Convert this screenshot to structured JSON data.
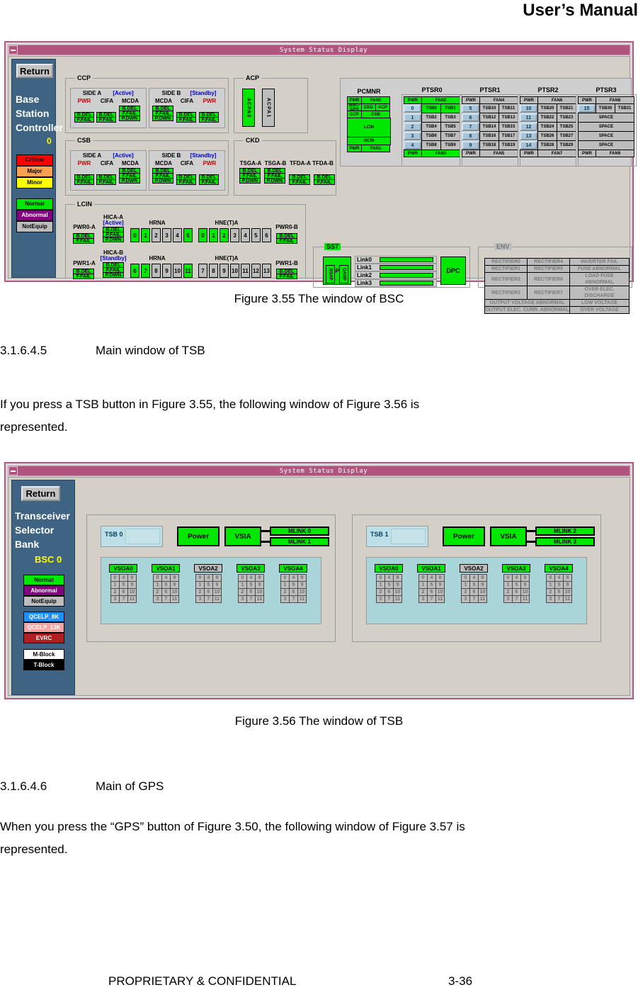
{
  "page": {
    "header_title": "User’s Manual",
    "footer_left": "PROPRIETARY & CONFIDENTIAL",
    "footer_right": "3-36"
  },
  "figures": {
    "fig355_caption": "Figure 3.55 The window of BSC",
    "fig356_caption": "Figure 3.56 The window of TSB"
  },
  "sections": [
    {
      "number": "3.1.6.4.5",
      "title": "Main window of TSB",
      "body_line1": "If you press a TSB button in Figure 3.55, the following window of  Figure 3.56 is",
      "body_line2": "represented."
    },
    {
      "number": "3.1.6.4.6",
      "title": "Main of GPS",
      "body_line1": "When you press the “GPS” button of Figure 3.50, the following window of Figure 3.57 is",
      "body_line2": "represented."
    }
  ],
  "bsc_window": {
    "titlebar": "System Status Display",
    "sidebar": {
      "return_label": "Return",
      "label_lines": [
        "Base",
        "Station",
        "Controller"
      ],
      "instance": "0",
      "legend_alarm": [
        {
          "label": "Critical",
          "color": "#ff0000",
          "text": "#000000"
        },
        {
          "label": "Major",
          "color": "#f9a055",
          "text": "#000000"
        },
        {
          "label": "Minor",
          "color": "#ffff00",
          "text": "#000000"
        }
      ],
      "legend_state": [
        {
          "label": "Normal",
          "color": "#00e800",
          "text": "#000000"
        },
        {
          "label": "Abnormal",
          "color": "#800080",
          "text": "#ffffff"
        },
        {
          "label": "NotEquip",
          "color": "#bdbdbd",
          "text": "#000000"
        }
      ]
    },
    "ccp": {
      "group_label": "CCP",
      "side_a": {
        "title": "SIDE A",
        "state": "[Active]",
        "columns": [
          "PWR",
          "CIFA",
          "MCDA"
        ]
      },
      "side_b": {
        "title": "SIDE B",
        "state": "[Standby]",
        "columns": [
          "MCDA",
          "CIFA",
          "PWR"
        ]
      },
      "cells": [
        "B.DEL",
        "F.FAIL",
        "P.DWN"
      ]
    },
    "csb": {
      "group_label": "CSB",
      "side_a": {
        "title": "SIDE A",
        "state": "[Active]",
        "columns": [
          "PWR",
          "CIFA",
          "MCDA"
        ]
      },
      "side_b": {
        "title": "SIDE B",
        "state": "[Standby]",
        "columns": [
          "MCDA",
          "CIFA",
          "PWR"
        ]
      },
      "cells": [
        "B.DEL",
        "F.FAIL",
        "P.DWN"
      ]
    },
    "acp": {
      "group_label": "ACP",
      "units": [
        {
          "label": "ACPA0",
          "state": "normal"
        },
        {
          "label": "ACPA1",
          "state": "notequip"
        }
      ]
    },
    "ckd": {
      "group_label": "CKD",
      "columns": [
        "TSGA-A",
        "TSGA-B",
        "TFDA-A",
        "TFDA-B"
      ],
      "tsga_cells": [
        "B.DEL",
        "F.FAIL",
        "P.DWN"
      ],
      "tfda_cells": [
        "B.DEL",
        "F.FAIL"
      ]
    },
    "lcin": {
      "group_label": "LCIN",
      "row_a": {
        "pwr_left": "PWR0-A",
        "hica": "HICA-A",
        "hica_state": "[Active]",
        "hica_cells": [
          "B.DEL",
          "F.FAIL",
          "P.DWN"
        ],
        "hrna_label": "HRNA",
        "hrna_slots": [
          {
            "n": "0",
            "on": true
          },
          {
            "n": "1",
            "on": true
          },
          {
            "n": "2",
            "on": false
          },
          {
            "n": "3",
            "on": false
          },
          {
            "n": "4",
            "on": false
          },
          {
            "n": "5",
            "on": true
          }
        ],
        "hnet_label": "HNE(T)A",
        "hnet_slots": [
          {
            "n": "0",
            "on": true
          },
          {
            "n": "1",
            "on": true
          },
          {
            "n": "2",
            "on": true
          },
          {
            "n": "3",
            "on": false
          },
          {
            "n": "4",
            "on": false
          },
          {
            "n": "5",
            "on": false
          },
          {
            "n": "6",
            "on": false
          }
        ],
        "pwr_right": "PWR0-B",
        "pwr_cells": [
          "B.DEL",
          "F.FAIL"
        ]
      },
      "row_b": {
        "pwr_left": "PWR1-A",
        "hica": "HICA-B",
        "hica_state": "[Standby]",
        "hica_cells": [
          "B.DEL",
          "F.FAIL",
          "P.DWN"
        ],
        "hrna_label": "HRNA",
        "hrna_slots": [
          {
            "n": "6",
            "on": true
          },
          {
            "n": "7",
            "on": true
          },
          {
            "n": "8",
            "on": false
          },
          {
            "n": "9",
            "on": false
          },
          {
            "n": "10",
            "on": false
          },
          {
            "n": "11",
            "on": true
          }
        ],
        "hnet_label": "HNE(T)A",
        "hnet_slots": [
          {
            "n": "7",
            "on": false
          },
          {
            "n": "8",
            "on": false
          },
          {
            "n": "9",
            "on": false
          },
          {
            "n": "10",
            "on": false
          },
          {
            "n": "11",
            "on": false
          },
          {
            "n": "12",
            "on": false
          },
          {
            "n": "13",
            "on": false
          }
        ],
        "pwr_right": "PWR1-B",
        "pwr_cells": [
          "B.DEL",
          "F.FAIL"
        ]
      }
    },
    "racks": {
      "pcmnr": {
        "title": "PCMNR",
        "rows": [
          [
            {
              "t": "PWR",
              "s": "g",
              "w": 1
            },
            {
              "t": "FAN0",
              "s": "g",
              "w": 2
            }
          ],
          [
            {
              "t": "BSC-GPS",
              "s": "g",
              "w": 1
            },
            {
              "t": "CKD",
              "s": "g",
              "w": 1
            },
            {
              "t": "ACP",
              "s": "g",
              "w": 1
            }
          ],
          [
            {
              "t": "CCP",
              "s": "g",
              "w": 1
            },
            {
              "t": "CSB",
              "s": "g",
              "w": 2
            }
          ],
          [
            {
              "t": "LCIN",
              "s": "g",
              "w": 3
            }
          ],
          [
            {
              "t": "GCIN",
              "s": "g",
              "w": 3
            }
          ],
          [
            {
              "t": "PWR",
              "s": "g",
              "w": 1
            },
            {
              "t": "FAN1",
              "s": "g",
              "w": 2
            }
          ]
        ]
      },
      "ptsr": [
        {
          "title": "PTSR0",
          "top": [
            "PWR",
            "FAN2"
          ],
          "bottom": [
            "PWR",
            "FAN3"
          ],
          "header_state": "g",
          "rows": [
            {
              "btn": "0",
              "btn_on": true,
              "tsb": [
                "TSB0",
                "TSB1"
              ],
              "tsb_state": "g"
            },
            {
              "btn": "1",
              "btn_on": false,
              "tsb": [
                "TSB2",
                "TSB3"
              ],
              "tsb_state": "ng"
            },
            {
              "btn": "2",
              "btn_on": false,
              "tsb": [
                "TSB4",
                "TSB5"
              ],
              "tsb_state": "ng"
            },
            {
              "btn": "3",
              "btn_on": false,
              "tsb": [
                "TSB6",
                "TSB7"
              ],
              "tsb_state": "ng"
            },
            {
              "btn": "4",
              "btn_on": false,
              "tsb": [
                "TSB8",
                "TSB9"
              ],
              "tsb_state": "ng"
            }
          ]
        },
        {
          "title": "PTSR1",
          "top": [
            "PWR",
            "FAN4"
          ],
          "bottom": [
            "PWR",
            "FAN5"
          ],
          "header_state": "ng",
          "rows": [
            {
              "btn": "5",
              "btn_on": false,
              "tsb": [
                "TSB10",
                "TSB11"
              ],
              "tsb_state": "ng"
            },
            {
              "btn": "6",
              "btn_on": false,
              "tsb": [
                "TSB12",
                "TSB13"
              ],
              "tsb_state": "ng"
            },
            {
              "btn": "7",
              "btn_on": false,
              "tsb": [
                "TSB14",
                "TSB15"
              ],
              "tsb_state": "ng"
            },
            {
              "btn": "8",
              "btn_on": false,
              "tsb": [
                "TSB16",
                "TSB17"
              ],
              "tsb_state": "ng"
            },
            {
              "btn": "9",
              "btn_on": false,
              "tsb": [
                "TSB18",
                "TSB19"
              ],
              "tsb_state": "ng"
            }
          ]
        },
        {
          "title": "PTSR2",
          "top": [
            "PWR",
            "FAN6"
          ],
          "bottom": [
            "PWR",
            "FAN7"
          ],
          "header_state": "ng",
          "rows": [
            {
              "btn": "10",
              "btn_on": false,
              "tsb": [
                "TSB20",
                "TSB21"
              ],
              "tsb_state": "ng"
            },
            {
              "btn": "11",
              "btn_on": false,
              "tsb": [
                "TSB22",
                "TSB23"
              ],
              "tsb_state": "ng"
            },
            {
              "btn": "12",
              "btn_on": false,
              "tsb": [
                "TSB24",
                "TSB25"
              ],
              "tsb_state": "ng"
            },
            {
              "btn": "13",
              "btn_on": false,
              "tsb": [
                "TSB26",
                "TSB27"
              ],
              "tsb_state": "ng"
            },
            {
              "btn": "14",
              "btn_on": false,
              "tsb": [
                "TSB28",
                "TSB29"
              ],
              "tsb_state": "ng"
            }
          ]
        },
        {
          "title": "PTSR3",
          "top": [
            "PWR",
            "FAN8"
          ],
          "bottom": [
            "PWR",
            "FAN9"
          ],
          "header_state": "ng",
          "rows": [
            {
              "btn": "15",
              "btn_on": false,
              "tsb": [
                "TSB30",
                "TSB31"
              ],
              "tsb_state": "ng"
            },
            {
              "span": "SPACE"
            },
            {
              "span": "SPACE"
            },
            {
              "span": "SPACE"
            },
            {
              "span": "SPACE"
            }
          ]
        }
      ]
    },
    "ss7": {
      "group_label": "SS7",
      "opc_label": "OPC",
      "opc_units": [
        "BSAP",
        "OAMP"
      ],
      "links": [
        "Link0",
        "Link1",
        "Link2",
        "Link3"
      ],
      "dpc_label": "DPC"
    },
    "env": {
      "group_label": "ENV",
      "rows": [
        [
          "RECTIFIER0",
          "RECTIFIER4",
          "INVERTER FAIL"
        ],
        [
          "RECTIFIER1",
          "RECTIFIER5",
          "FUSE ABNORMAL"
        ],
        [
          "RECTIFIER2",
          "RECTIFIER6",
          "LOAD FUSE ABNORMAL"
        ],
        [
          "RECTIFIER3",
          "RECTIFIER7",
          "OVER ELEC. DISCHARGE"
        ]
      ],
      "wide_rows": [
        [
          "OUTPUT VOLTAGE ABNORMAL",
          "LOW VOLTAGE"
        ],
        [
          "OUTPUT ELEC. CURR. ABNORMAL",
          "OVER VOLTAGE"
        ]
      ]
    }
  },
  "tsb_window": {
    "titlebar": "System Status Display",
    "sidebar": {
      "return_label": "Return",
      "label_lines": [
        "Transceiver",
        "Selector",
        "Bank"
      ],
      "instance": "BSC 0",
      "legend_state": [
        {
          "label": "Normal",
          "color": "#00e800",
          "text": "#000000"
        },
        {
          "label": "Abnormal",
          "color": "#800080",
          "text": "#ffffff"
        },
        {
          "label": "NotEquip",
          "color": "#bdbdbd",
          "text": "#000000"
        }
      ],
      "legend_vocoder": [
        {
          "label": "QCELP_8K",
          "color": "#1e90ff",
          "text": "#ffffff"
        },
        {
          "label": "QCELP_13K",
          "color": "#f4a3a3",
          "text": "#ffffff"
        },
        {
          "label": "EVRC",
          "color": "#b02020",
          "text": "#ffffff"
        }
      ],
      "legend_block": [
        {
          "label": "M-Block",
          "color": "#ffffff",
          "text": "#000000"
        },
        {
          "label": "T-Block",
          "color": "#000000",
          "text": "#ffffff"
        }
      ]
    },
    "banks": [
      {
        "name": "TSB 0",
        "power_label": "Power",
        "vsia_label": "VSIA",
        "mlinks": [
          "MLINK 0",
          "MLINK 1"
        ],
        "vsoa": [
          {
            "label": "VSOA0",
            "state": "g"
          },
          {
            "label": "VSOA1",
            "state": "g"
          },
          {
            "label": "VSOA2",
            "state": "ng"
          },
          {
            "label": "VSOA3",
            "state": "g"
          },
          {
            "label": "VSOA4",
            "state": "g"
          }
        ],
        "channel_grid": [
          [
            "0",
            "4",
            "8"
          ],
          [
            "1",
            "5",
            "9"
          ],
          [
            "2",
            "6",
            "10"
          ],
          [
            "3",
            "7",
            "11"
          ]
        ]
      },
      {
        "name": "TSB 1",
        "power_label": "Power",
        "vsia_label": "VSIA",
        "mlinks": [
          "MLINK 2",
          "MLINK 3"
        ],
        "vsoa": [
          {
            "label": "VSOA0",
            "state": "g"
          },
          {
            "label": "VSOA1",
            "state": "g"
          },
          {
            "label": "VSOA2",
            "state": "ng"
          },
          {
            "label": "VSOA3",
            "state": "g"
          },
          {
            "label": "VSOA4",
            "state": "g"
          }
        ],
        "channel_grid": [
          [
            "0",
            "4",
            "8"
          ],
          [
            "1",
            "5",
            "9"
          ],
          [
            "2",
            "6",
            "10"
          ],
          [
            "3",
            "7",
            "11"
          ]
        ]
      }
    ]
  }
}
